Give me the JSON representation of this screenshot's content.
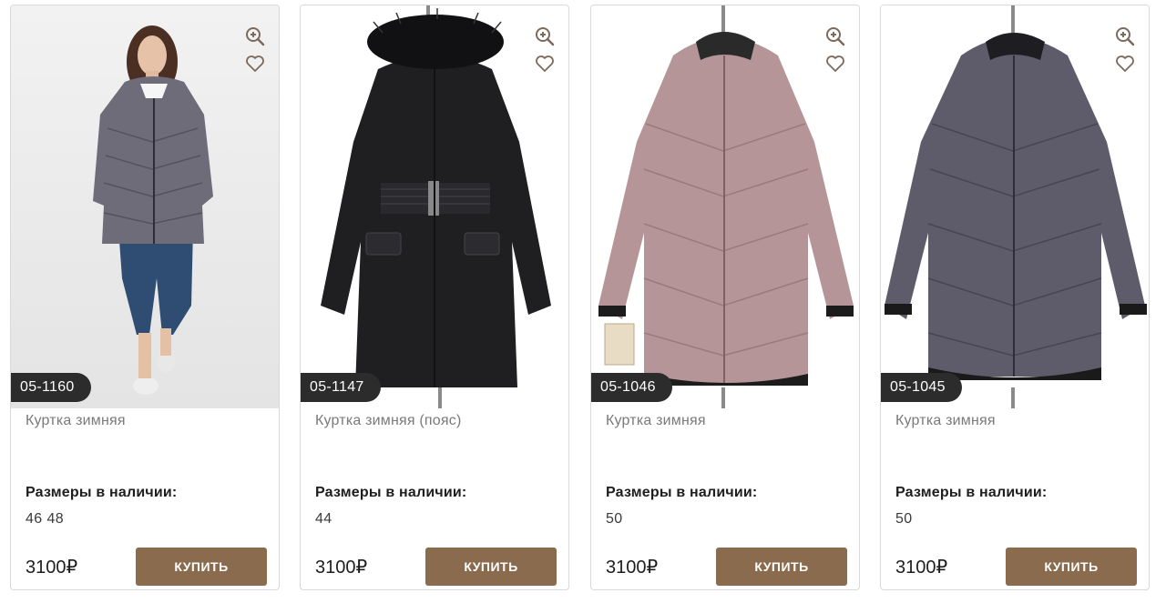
{
  "products": [
    {
      "sku": "05-1160",
      "title": "Куртка зимняя",
      "sizes_label": "Размеры в наличии:",
      "sizes": "46 48",
      "price": "3100₽",
      "buy_label": "КУПИТЬ",
      "photo": "model",
      "coat_color": "#6f6c7a"
    },
    {
      "sku": "05-1147",
      "title": "Куртка зимняя (пояс)",
      "sizes_label": "Размеры в наличии:",
      "sizes": "44",
      "price": "3100₽",
      "buy_label": "КУПИТЬ",
      "photo": "black-fur",
      "coat_color": "#1f1f22"
    },
    {
      "sku": "05-1046",
      "title": "Куртка зимняя",
      "sizes_label": "Размеры в наличии:",
      "sizes": "50",
      "price": "3100₽",
      "buy_label": "КУПИТЬ",
      "photo": "pink",
      "coat_color": "#b59597"
    },
    {
      "sku": "05-1045",
      "title": "Куртка зимняя",
      "sizes_label": "Размеры в наличии:",
      "sizes": "50",
      "price": "3100₽",
      "buy_label": "КУПИТЬ",
      "photo": "grey",
      "coat_color": "#5e5c6b"
    }
  ],
  "theme": {
    "button_color": "#8a6b4d",
    "badge_color": "#2c2c2c",
    "icon_color": "#7c6a5c"
  },
  "icons": {
    "zoom": "zoom-in-icon",
    "favorite": "heart-icon"
  }
}
